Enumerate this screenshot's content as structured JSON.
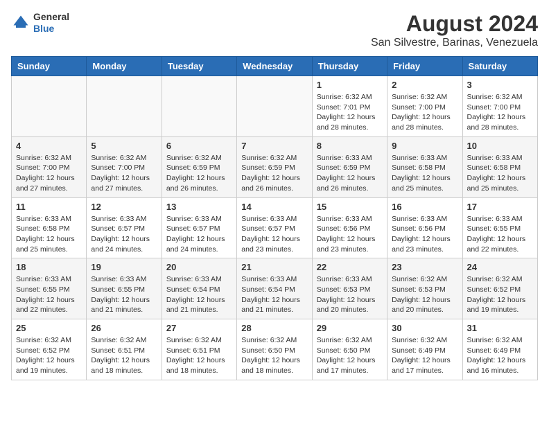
{
  "header": {
    "logo_line1": "General",
    "logo_line2": "Blue",
    "title": "August 2024",
    "subtitle": "San Silvestre, Barinas, Venezuela"
  },
  "calendar": {
    "days_of_week": [
      "Sunday",
      "Monday",
      "Tuesday",
      "Wednesday",
      "Thursday",
      "Friday",
      "Saturday"
    ],
    "weeks": [
      [
        {
          "day": "",
          "info": ""
        },
        {
          "day": "",
          "info": ""
        },
        {
          "day": "",
          "info": ""
        },
        {
          "day": "",
          "info": ""
        },
        {
          "day": "1",
          "info": "Sunrise: 6:32 AM\nSunset: 7:01 PM\nDaylight: 12 hours and 28 minutes."
        },
        {
          "day": "2",
          "info": "Sunrise: 6:32 AM\nSunset: 7:00 PM\nDaylight: 12 hours and 28 minutes."
        },
        {
          "day": "3",
          "info": "Sunrise: 6:32 AM\nSunset: 7:00 PM\nDaylight: 12 hours and 28 minutes."
        }
      ],
      [
        {
          "day": "4",
          "info": "Sunrise: 6:32 AM\nSunset: 7:00 PM\nDaylight: 12 hours and 27 minutes."
        },
        {
          "day": "5",
          "info": "Sunrise: 6:32 AM\nSunset: 7:00 PM\nDaylight: 12 hours and 27 minutes."
        },
        {
          "day": "6",
          "info": "Sunrise: 6:32 AM\nSunset: 6:59 PM\nDaylight: 12 hours and 26 minutes."
        },
        {
          "day": "7",
          "info": "Sunrise: 6:32 AM\nSunset: 6:59 PM\nDaylight: 12 hours and 26 minutes."
        },
        {
          "day": "8",
          "info": "Sunrise: 6:33 AM\nSunset: 6:59 PM\nDaylight: 12 hours and 26 minutes."
        },
        {
          "day": "9",
          "info": "Sunrise: 6:33 AM\nSunset: 6:58 PM\nDaylight: 12 hours and 25 minutes."
        },
        {
          "day": "10",
          "info": "Sunrise: 6:33 AM\nSunset: 6:58 PM\nDaylight: 12 hours and 25 minutes."
        }
      ],
      [
        {
          "day": "11",
          "info": "Sunrise: 6:33 AM\nSunset: 6:58 PM\nDaylight: 12 hours and 25 minutes."
        },
        {
          "day": "12",
          "info": "Sunrise: 6:33 AM\nSunset: 6:57 PM\nDaylight: 12 hours and 24 minutes."
        },
        {
          "day": "13",
          "info": "Sunrise: 6:33 AM\nSunset: 6:57 PM\nDaylight: 12 hours and 24 minutes."
        },
        {
          "day": "14",
          "info": "Sunrise: 6:33 AM\nSunset: 6:57 PM\nDaylight: 12 hours and 23 minutes."
        },
        {
          "day": "15",
          "info": "Sunrise: 6:33 AM\nSunset: 6:56 PM\nDaylight: 12 hours and 23 minutes."
        },
        {
          "day": "16",
          "info": "Sunrise: 6:33 AM\nSunset: 6:56 PM\nDaylight: 12 hours and 23 minutes."
        },
        {
          "day": "17",
          "info": "Sunrise: 6:33 AM\nSunset: 6:55 PM\nDaylight: 12 hours and 22 minutes."
        }
      ],
      [
        {
          "day": "18",
          "info": "Sunrise: 6:33 AM\nSunset: 6:55 PM\nDaylight: 12 hours and 22 minutes."
        },
        {
          "day": "19",
          "info": "Sunrise: 6:33 AM\nSunset: 6:55 PM\nDaylight: 12 hours and 21 minutes."
        },
        {
          "day": "20",
          "info": "Sunrise: 6:33 AM\nSunset: 6:54 PM\nDaylight: 12 hours and 21 minutes."
        },
        {
          "day": "21",
          "info": "Sunrise: 6:33 AM\nSunset: 6:54 PM\nDaylight: 12 hours and 21 minutes."
        },
        {
          "day": "22",
          "info": "Sunrise: 6:33 AM\nSunset: 6:53 PM\nDaylight: 12 hours and 20 minutes."
        },
        {
          "day": "23",
          "info": "Sunrise: 6:32 AM\nSunset: 6:53 PM\nDaylight: 12 hours and 20 minutes."
        },
        {
          "day": "24",
          "info": "Sunrise: 6:32 AM\nSunset: 6:52 PM\nDaylight: 12 hours and 19 minutes."
        }
      ],
      [
        {
          "day": "25",
          "info": "Sunrise: 6:32 AM\nSunset: 6:52 PM\nDaylight: 12 hours and 19 minutes."
        },
        {
          "day": "26",
          "info": "Sunrise: 6:32 AM\nSunset: 6:51 PM\nDaylight: 12 hours and 18 minutes."
        },
        {
          "day": "27",
          "info": "Sunrise: 6:32 AM\nSunset: 6:51 PM\nDaylight: 12 hours and 18 minutes."
        },
        {
          "day": "28",
          "info": "Sunrise: 6:32 AM\nSunset: 6:50 PM\nDaylight: 12 hours and 18 minutes."
        },
        {
          "day": "29",
          "info": "Sunrise: 6:32 AM\nSunset: 6:50 PM\nDaylight: 12 hours and 17 minutes."
        },
        {
          "day": "30",
          "info": "Sunrise: 6:32 AM\nSunset: 6:49 PM\nDaylight: 12 hours and 17 minutes."
        },
        {
          "day": "31",
          "info": "Sunrise: 6:32 AM\nSunset: 6:49 PM\nDaylight: 12 hours and 16 minutes."
        }
      ]
    ]
  }
}
